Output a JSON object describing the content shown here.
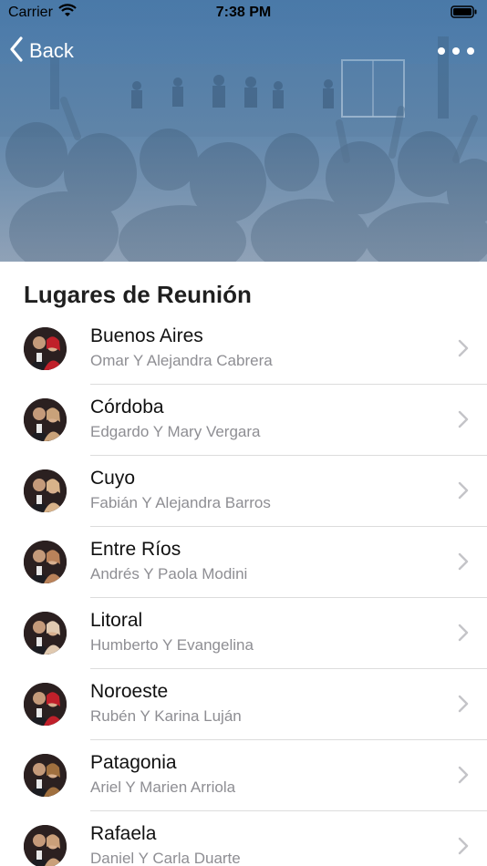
{
  "status_bar": {
    "carrier": "Carrier",
    "time": "7:38 PM"
  },
  "nav": {
    "back_label": "Back"
  },
  "section": {
    "title": "Lugares de Reunión"
  },
  "items": [
    {
      "title": "Buenos Aires",
      "subtitle": "Omar Y Alejandra Cabrera",
      "accent": "#c0202a"
    },
    {
      "title": "Córdoba",
      "subtitle": "Edgardo Y Mary Vergara",
      "accent": "#c9a27a"
    },
    {
      "title": "Cuyo",
      "subtitle": "Fabián Y Alejandra Barros",
      "accent": "#d8b38a"
    },
    {
      "title": "Entre Ríos",
      "subtitle": "Andrés Y Paola Modini",
      "accent": "#b9825a"
    },
    {
      "title": "Litoral",
      "subtitle": "Humberto Y Evangelina",
      "accent": "#e0c9b0"
    },
    {
      "title": "Noroeste",
      "subtitle": "Rubén Y Karina Luján",
      "accent": "#c0202a"
    },
    {
      "title": "Patagonia",
      "subtitle": "Ariel Y Marien Arriola",
      "accent": "#a0703f"
    },
    {
      "title": "Rafaela",
      "subtitle": "Daniel Y Carla Duarte",
      "accent": "#caa07a"
    }
  ]
}
